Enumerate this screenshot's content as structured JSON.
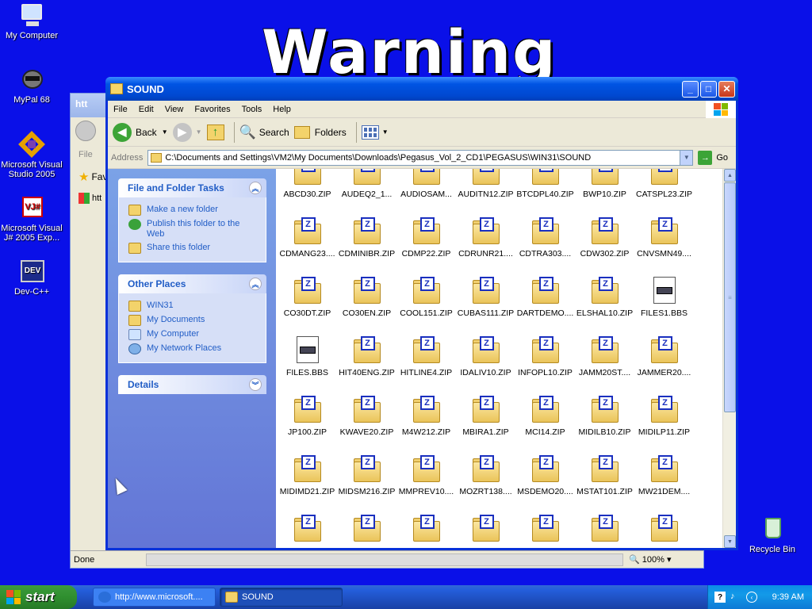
{
  "desktop": {
    "banner_text": "Warning",
    "icons": [
      {
        "label": "My Computer",
        "icon": "computer-icon"
      },
      {
        "label": "MyPal 68",
        "icon": "raccoon-icon"
      },
      {
        "label": "Microsoft Visual Studio 2005",
        "icon": "visual-studio-icon"
      },
      {
        "label": "Microsoft Visual J# 2005 Exp...",
        "icon": "vj-icon"
      },
      {
        "label": "Dev-C++",
        "icon": "devcpp-icon"
      },
      {
        "label": "Recycle Bin",
        "icon": "recycle-bin-icon"
      }
    ]
  },
  "bg_window": {
    "title_fragment": "htt",
    "menu_fragment": "File",
    "favorites_fragment": "Fav",
    "link_fragment": "htt",
    "status": "Done",
    "zoom": "100%"
  },
  "window": {
    "title": "SOUND",
    "menu": [
      "File",
      "Edit",
      "View",
      "Favorites",
      "Tools",
      "Help"
    ],
    "toolbar": {
      "back": "Back",
      "search": "Search",
      "folders": "Folders"
    },
    "address_label": "Address",
    "address": "C:\\Documents and Settings\\VM2\\My Documents\\Downloads\\Pegasus_Vol_2_CD1\\PEGASUS\\WIN31\\SOUND",
    "go": "Go"
  },
  "tasks": {
    "file_folder": {
      "title": "File and Folder Tasks",
      "items": [
        "Make a new folder",
        "Publish this folder to the Web",
        "Share this folder"
      ]
    },
    "other_places": {
      "title": "Other Places",
      "items": [
        "WIN31",
        "My Documents",
        "My Computer",
        "My Network Places"
      ]
    },
    "details": {
      "title": "Details"
    }
  },
  "files": [
    {
      "name": "ABCD30.ZIP",
      "type": "zip"
    },
    {
      "name": "AUDEQ2_1...",
      "type": "zip"
    },
    {
      "name": "AUDIOSAM...",
      "type": "zip"
    },
    {
      "name": "AUDITN12.ZIP",
      "type": "zip"
    },
    {
      "name": "BTCDPL40.ZIP",
      "type": "zip"
    },
    {
      "name": "BWP10.ZIP",
      "type": "zip"
    },
    {
      "name": "CATSPL23.ZIP",
      "type": "zip"
    },
    {
      "name": "CDMANG23....",
      "type": "zip"
    },
    {
      "name": "CDMINIBR.ZIP",
      "type": "zip"
    },
    {
      "name": "CDMP22.ZIP",
      "type": "zip"
    },
    {
      "name": "CDRUNR21....",
      "type": "zip"
    },
    {
      "name": "CDTRA303....",
      "type": "zip"
    },
    {
      "name": "CDW302.ZIP",
      "type": "zip"
    },
    {
      "name": "CNVSMN49....",
      "type": "zip"
    },
    {
      "name": "CO30DT.ZIP",
      "type": "zip"
    },
    {
      "name": "CO30EN.ZIP",
      "type": "zip"
    },
    {
      "name": "COOL151.ZIP",
      "type": "zip"
    },
    {
      "name": "CUBAS111.ZIP",
      "type": "zip"
    },
    {
      "name": "DARTDEMO....",
      "type": "zip"
    },
    {
      "name": "ELSHAL10.ZIP",
      "type": "zip"
    },
    {
      "name": "FILES1.BBS",
      "type": "doc"
    },
    {
      "name": "FILES.BBS",
      "type": "doc"
    },
    {
      "name": "HIT40ENG.ZIP",
      "type": "zip"
    },
    {
      "name": "HITLINE4.ZIP",
      "type": "zip"
    },
    {
      "name": "IDALIV10.ZIP",
      "type": "zip"
    },
    {
      "name": "INFOPL10.ZIP",
      "type": "zip"
    },
    {
      "name": "JAMM20ST....",
      "type": "zip"
    },
    {
      "name": "JAMMER20....",
      "type": "zip"
    },
    {
      "name": "JP100.ZIP",
      "type": "zip"
    },
    {
      "name": "KWAVE20.ZIP",
      "type": "zip"
    },
    {
      "name": "M4W212.ZIP",
      "type": "zip"
    },
    {
      "name": "MBIRA1.ZIP",
      "type": "zip"
    },
    {
      "name": "MCI14.ZIP",
      "type": "zip"
    },
    {
      "name": "MIDILB10.ZIP",
      "type": "zip"
    },
    {
      "name": "MIDILP11.ZIP",
      "type": "zip"
    },
    {
      "name": "MIDIMD21.ZIP",
      "type": "zip"
    },
    {
      "name": "MIDSM216.ZIP",
      "type": "zip"
    },
    {
      "name": "MMPREV10....",
      "type": "zip"
    },
    {
      "name": "MOZRT138....",
      "type": "zip"
    },
    {
      "name": "MSDEMO20....",
      "type": "zip"
    },
    {
      "name": "MSTAT101.ZIP",
      "type": "zip"
    },
    {
      "name": "MW21DEM....",
      "type": "zip"
    },
    {
      "name": "",
      "type": "zip"
    },
    {
      "name": "",
      "type": "zip"
    },
    {
      "name": "",
      "type": "zip"
    },
    {
      "name": "",
      "type": "zip"
    },
    {
      "name": "",
      "type": "zip"
    },
    {
      "name": "",
      "type": "zip"
    },
    {
      "name": "",
      "type": "zip"
    }
  ],
  "taskbar": {
    "start": "start",
    "tasks": [
      {
        "label": "http://www.microsoft....",
        "icon": "ie-icon"
      },
      {
        "label": "SOUND",
        "icon": "folder-icon"
      }
    ],
    "time": "9:39 AM"
  }
}
